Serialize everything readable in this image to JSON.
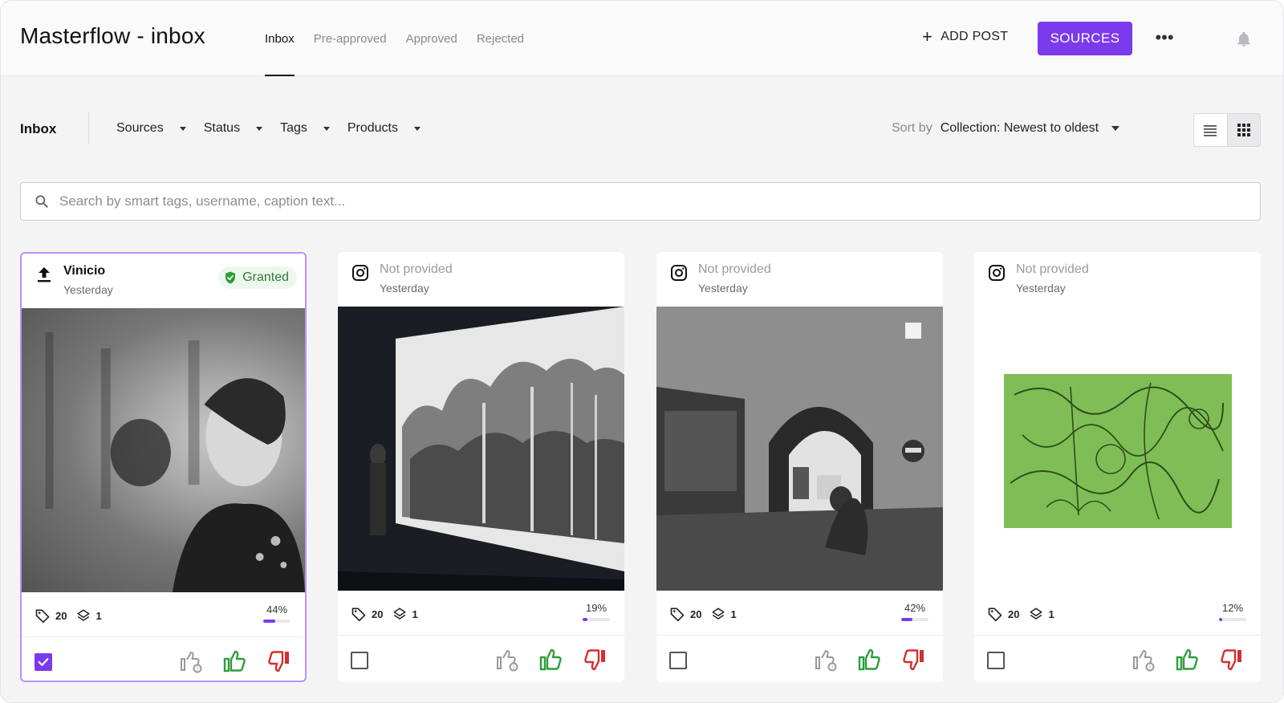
{
  "header": {
    "title": "Masterflow - inbox",
    "tabs": [
      "Inbox",
      "Pre-approved",
      "Approved",
      "Rejected"
    ],
    "active_tab": "Inbox",
    "add_post_label": "ADD POST",
    "sources_label": "SOURCES",
    "more_label": "•••"
  },
  "filters": {
    "label": "Inbox",
    "items": [
      "Sources",
      "Status",
      "Tags",
      "Products"
    ],
    "sort_label": "Sort by",
    "sort_value": "Collection: Newest to oldest",
    "view": "grid"
  },
  "search": {
    "placeholder": "Search by smart tags, username, caption text...",
    "value": ""
  },
  "colors": {
    "accent": "#7c3aed",
    "granted": "#2e7d32",
    "approve": "#2e9d3a",
    "reject": "#d32f2f"
  },
  "cards": [
    {
      "source_icon": "upload-icon",
      "user": "Vinicio",
      "date": "Yesterday",
      "badge": "Granted",
      "tags": "20",
      "layers": "1",
      "score": "44%",
      "score_value": 0.44,
      "checked": true
    },
    {
      "source_icon": "instagram-icon",
      "user": "Not provided",
      "date": "Yesterday",
      "badge": "",
      "tags": "20",
      "layers": "1",
      "score": "19%",
      "score_value": 0.19,
      "checked": false
    },
    {
      "source_icon": "instagram-icon",
      "user": "Not provided",
      "date": "Yesterday",
      "badge": "",
      "tags": "20",
      "layers": "1",
      "score": "42%",
      "score_value": 0.42,
      "checked": false
    },
    {
      "source_icon": "instagram-icon",
      "user": "Not provided",
      "date": "Yesterday",
      "badge": "",
      "tags": "20",
      "layers": "1",
      "score": "12%",
      "score_value": 0.12,
      "checked": false
    }
  ]
}
